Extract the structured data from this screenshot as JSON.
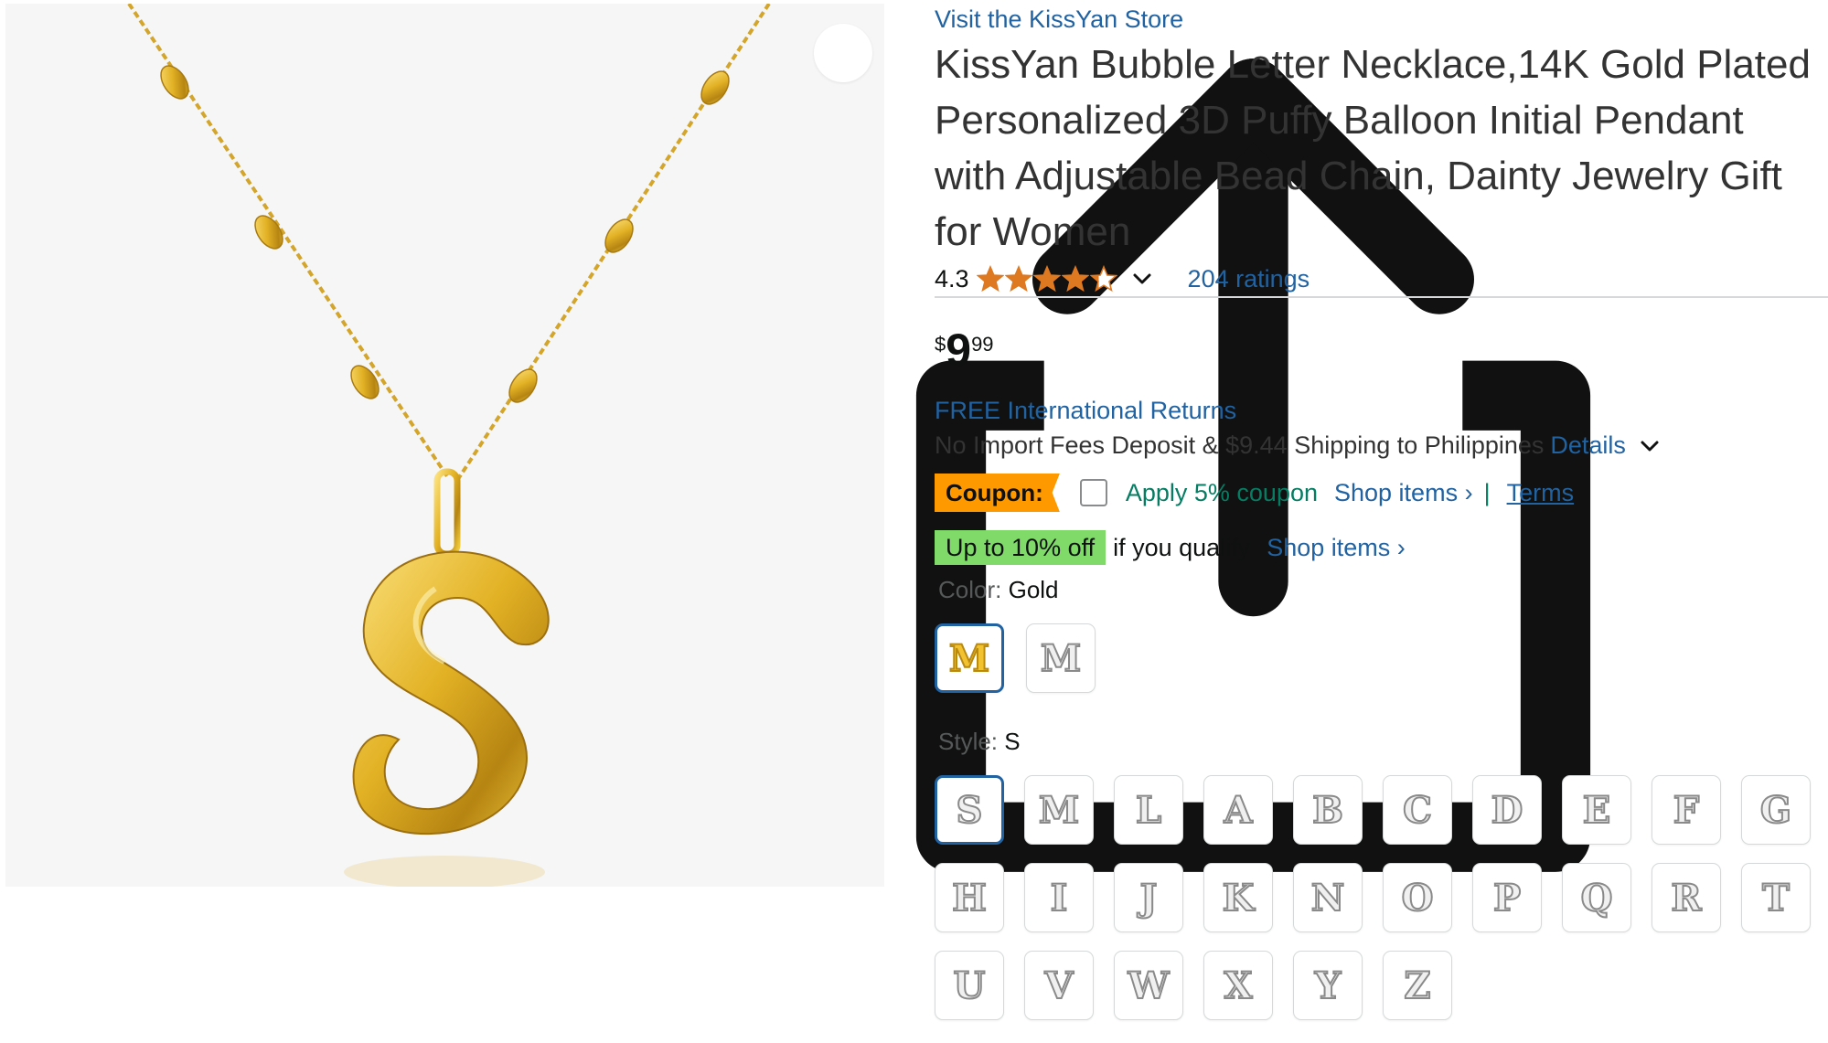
{
  "store_link": "Visit the KissYan Store",
  "title": "KissYan Bubble Letter Necklace,14K Gold Plated Personalized 3D Puffy Balloon Initial Pendant with Adjustable Bead Chain, Dainty Jewelry Gift for Women",
  "rating": {
    "value": "4.3",
    "stars_value": 4.3,
    "stars_max": 5,
    "count_label": "204 ratings"
  },
  "price": {
    "symbol": "$",
    "whole": "9",
    "fraction": "99"
  },
  "returns_label": "FREE International Returns",
  "shipping": {
    "text": "No Import Fees Deposit & $9.44 Shipping to Philippines",
    "details_label": "Details"
  },
  "coupon": {
    "badge": "Coupon:",
    "checked": false,
    "apply_text": "Apply 5% coupon",
    "shop_items": "Shop items ›",
    "separator": "|",
    "terms": "Terms"
  },
  "deal": {
    "badge": "Up to 10% off",
    "qualify_text": "if you qualify",
    "shop_items": "Shop items ›"
  },
  "color": {
    "label": "Color:",
    "selected": "Gold",
    "options": [
      {
        "glyph": "M",
        "variant": "gold",
        "selected": true
      },
      {
        "glyph": "M",
        "variant": "silver",
        "selected": false
      }
    ]
  },
  "style": {
    "label": "Style:",
    "selected": "S",
    "options": [
      "S",
      "M",
      "L",
      "A",
      "B",
      "C",
      "D",
      "E",
      "F",
      "G",
      "H",
      "I",
      "J",
      "K",
      "N",
      "O",
      "P",
      "Q",
      "R",
      "T",
      "U",
      "V",
      "W",
      "X",
      "Y",
      "Z"
    ]
  },
  "colors": {
    "link": "#2162a1",
    "coupon_badge": "#ff9900",
    "deal_badge": "#7fda69",
    "coupon_text": "#067d62",
    "star": "#de7921",
    "selected_border": "#2162a1"
  },
  "icons": [
    "share-icon",
    "star-icon",
    "chevron-down-icon"
  ],
  "product_image": "gold bubble letter S pendant on bead chain"
}
